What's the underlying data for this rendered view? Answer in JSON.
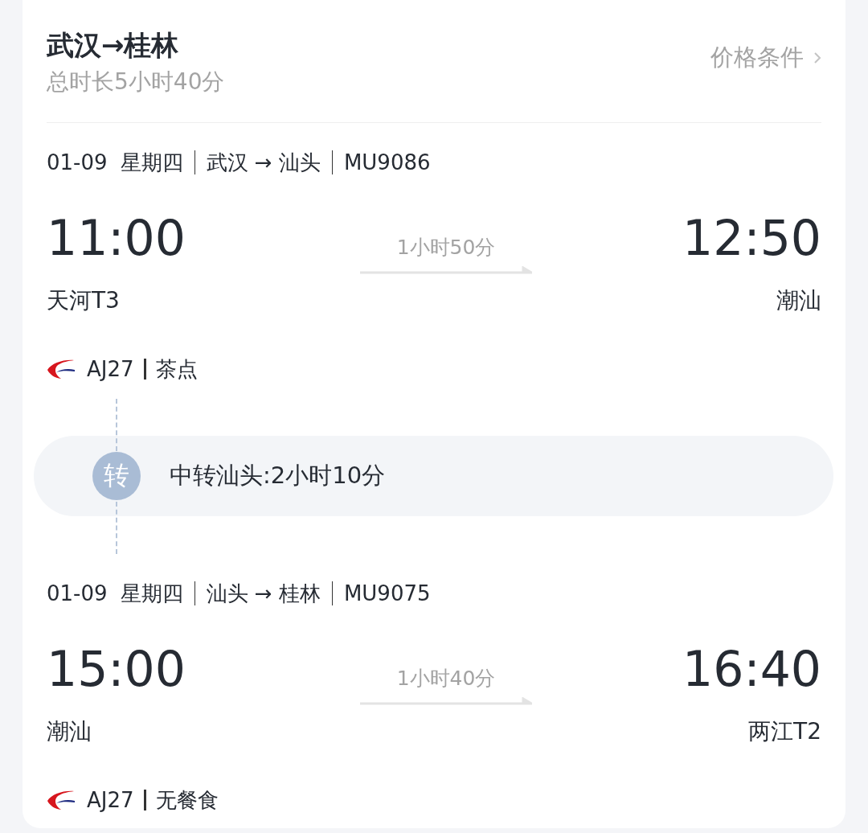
{
  "header": {
    "title": "武汉→桂林",
    "total_duration": "总时长5小时40分",
    "price_link": "价格条件"
  },
  "segments": [
    {
      "kind": "leg",
      "date": "01-09",
      "weekday": "星期四",
      "route": "武汉 → 汕头",
      "flight_no": "MU9086",
      "depart_time": "11:00",
      "arrive_time": "12:50",
      "duration": "1小时50分",
      "depart_airport": "天河T3",
      "arrive_airport": "潮汕",
      "aircraft": "AJ27",
      "meal": "茶点"
    },
    {
      "kind": "transfer",
      "badge": "转",
      "text": "中转汕头:2小时10分"
    },
    {
      "kind": "leg",
      "date": "01-09",
      "weekday": "星期四",
      "route": "汕头 → 桂林",
      "flight_no": "MU9075",
      "depart_time": "15:00",
      "arrive_time": "16:40",
      "duration": "1小时40分",
      "depart_airport": "潮汕",
      "arrive_airport": "两江T2",
      "aircraft": "AJ27",
      "meal": "无餐食"
    }
  ]
}
